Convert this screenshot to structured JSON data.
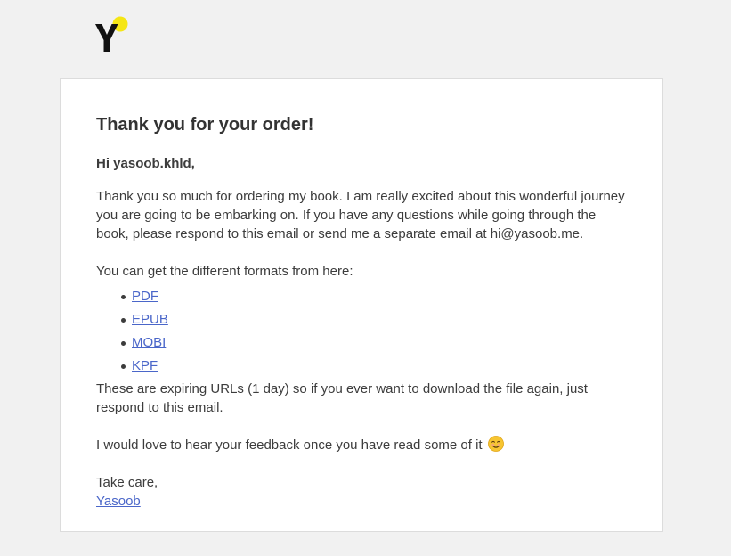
{
  "brand": {
    "logo_letter": "Y",
    "accent_color": "#f5e614"
  },
  "email": {
    "title": "Thank you for your order!",
    "greeting": "Hi yasoob.khld,",
    "intro": "Thank you so much for ordering my book. I am really excited about this wonderful journey you are going to be embarking on. If you have any questions while going through the book, please respond to this email or send me a separate email at hi@yasoob.me.",
    "formats_intro": "You can get the different formats from here:",
    "formats": [
      {
        "label": "PDF"
      },
      {
        "label": "EPUB"
      },
      {
        "label": "MOBI"
      },
      {
        "label": "KPF"
      }
    ],
    "expiry_note": "These are expiring URLs (1 day) so if you ever want to download the file again, just respond to this email.",
    "feedback": "I would love to hear your feedback once you have read some of it",
    "feedback_emoji": "smiling-face-icon",
    "closing": "Take care,",
    "signature": "Yasoob",
    "link_color": "#4a66c9"
  }
}
